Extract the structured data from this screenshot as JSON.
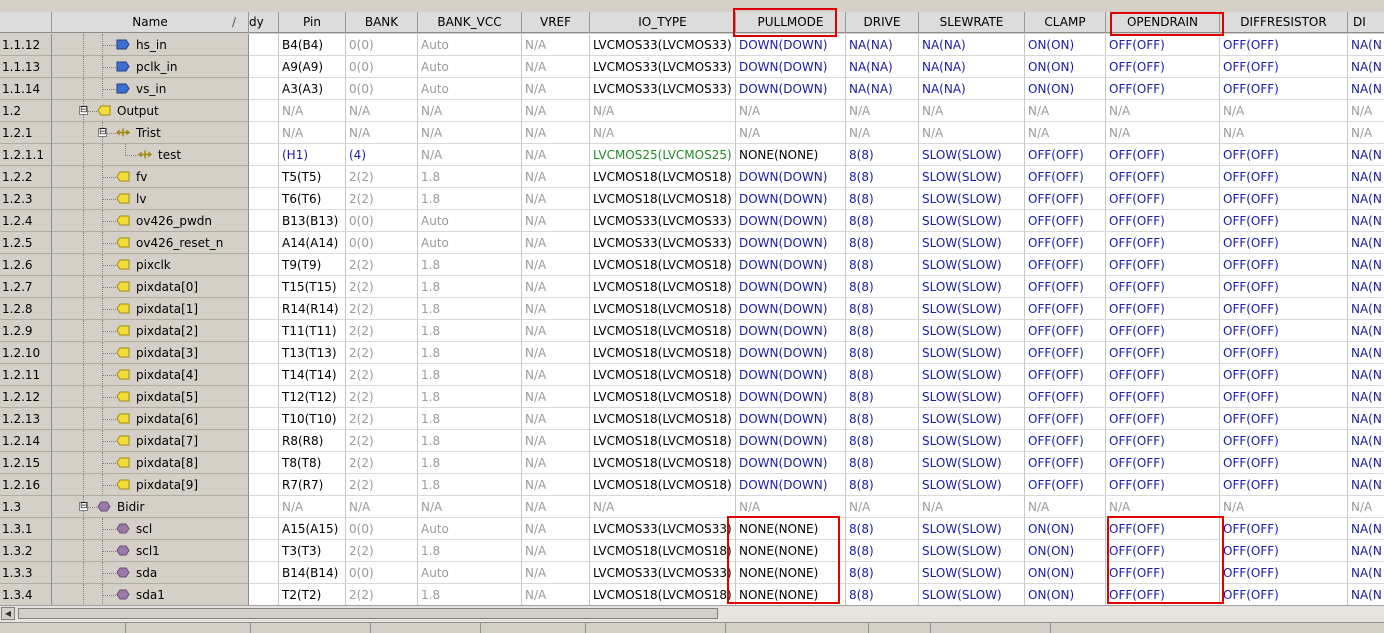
{
  "columns": [
    {
      "key": "name",
      "label": "Name"
    },
    {
      "key": "dy",
      "label": "dy"
    },
    {
      "key": "pin",
      "label": "Pin"
    },
    {
      "key": "bank",
      "label": "BANK"
    },
    {
      "key": "bank_vcc",
      "label": "BANK_VCC"
    },
    {
      "key": "vref",
      "label": "VREF"
    },
    {
      "key": "io_type",
      "label": "IO_TYPE"
    },
    {
      "key": "pullmode",
      "label": "PULLMODE"
    },
    {
      "key": "drive",
      "label": "DRIVE"
    },
    {
      "key": "slewrate",
      "label": "SLEWRATE"
    },
    {
      "key": "clamp",
      "label": "CLAMP"
    },
    {
      "key": "opendrain",
      "label": "OPENDRAIN"
    },
    {
      "key": "diffresistor",
      "label": "DIFFRESISTOR"
    },
    {
      "key": "di",
      "label": "DI"
    }
  ],
  "colors": {
    "value_blue": "#1a1aa6",
    "na_gray": "#9a9a9a",
    "iotype_green": "#238a23",
    "highlight_red": "#e00000",
    "input_icon_blue": "#3b6fd1",
    "output_icon_yellow": "#f2dc3c",
    "bidir_icon_purple": "#9a7aa8"
  },
  "rows": [
    {
      "index": "1.1.12",
      "name": "hs_in",
      "icon": "input-port-icon",
      "pin": "B4(B4)",
      "bank": "0(0)",
      "bank_vcc": "Auto",
      "vref": "N/A",
      "io_type": "LVCMOS33(LVCMOS33)",
      "pullmode": "DOWN(DOWN)",
      "drive": "NA(NA)",
      "slewrate": "NA(NA)",
      "clamp": "ON(ON)",
      "opendrain": "OFF(OFF)",
      "diffresistor": "OFF(OFF)",
      "di": "NA(N"
    },
    {
      "index": "1.1.13",
      "name": "pclk_in",
      "icon": "input-port-icon",
      "pin": "A9(A9)",
      "bank": "0(0)",
      "bank_vcc": "Auto",
      "vref": "N/A",
      "io_type": "LVCMOS33(LVCMOS33)",
      "pullmode": "DOWN(DOWN)",
      "drive": "NA(NA)",
      "slewrate": "NA(NA)",
      "clamp": "ON(ON)",
      "opendrain": "OFF(OFF)",
      "diffresistor": "OFF(OFF)",
      "di": "NA(N"
    },
    {
      "index": "1.1.14",
      "name": "vs_in",
      "icon": "input-port-icon",
      "pin": "A3(A3)",
      "bank": "0(0)",
      "bank_vcc": "Auto",
      "vref": "N/A",
      "io_type": "LVCMOS33(LVCMOS33)",
      "pullmode": "DOWN(DOWN)",
      "drive": "NA(NA)",
      "slewrate": "NA(NA)",
      "clamp": "ON(ON)",
      "opendrain": "OFF(OFF)",
      "diffresistor": "OFF(OFF)",
      "di": "NA(N"
    },
    {
      "index": "1.2",
      "name": "Output",
      "icon": "output-group-icon",
      "expander": "⊟",
      "pin": "N/A",
      "bank": "N/A",
      "bank_vcc": "N/A",
      "vref": "N/A",
      "io_type": "N/A",
      "pullmode": "N/A",
      "drive": "N/A",
      "slewrate": "N/A",
      "clamp": "N/A",
      "opendrain": "N/A",
      "diffresistor": "N/A",
      "di": "N/A"
    },
    {
      "index": "1.2.1",
      "name": "Trist",
      "icon": "tristate-group-icon",
      "expander": "⊟",
      "pin": "N/A",
      "bank": "N/A",
      "bank_vcc": "N/A",
      "vref": "N/A",
      "io_type": "N/A",
      "pullmode": "N/A",
      "drive": "N/A",
      "slewrate": "N/A",
      "clamp": "N/A",
      "opendrain": "N/A",
      "diffresistor": "N/A",
      "di": "N/A"
    },
    {
      "index": "1.2.1.1",
      "name": "test",
      "icon": "tristate-port-icon",
      "pin": "(H1)",
      "bank": "(4)",
      "bank_vcc": "N/A",
      "vref": "N/A",
      "io_type": "LVCMOS25(LVCMOS25)",
      "pullmode": "NONE(NONE)",
      "drive": "8(8)",
      "slewrate": "SLOW(SLOW)",
      "clamp": "OFF(OFF)",
      "opendrain": "OFF(OFF)",
      "diffresistor": "OFF(OFF)",
      "di": "NA(N"
    },
    {
      "index": "1.2.2",
      "name": "fv",
      "icon": "output-port-icon",
      "pin": "T5(T5)",
      "bank": "2(2)",
      "bank_vcc": "1.8",
      "vref": "N/A",
      "io_type": "LVCMOS18(LVCMOS18)",
      "pullmode": "DOWN(DOWN)",
      "drive": "8(8)",
      "slewrate": "SLOW(SLOW)",
      "clamp": "OFF(OFF)",
      "opendrain": "OFF(OFF)",
      "diffresistor": "OFF(OFF)",
      "di": "NA(N"
    },
    {
      "index": "1.2.3",
      "name": "lv",
      "icon": "output-port-icon",
      "pin": "T6(T6)",
      "bank": "2(2)",
      "bank_vcc": "1.8",
      "vref": "N/A",
      "io_type": "LVCMOS18(LVCMOS18)",
      "pullmode": "DOWN(DOWN)",
      "drive": "8(8)",
      "slewrate": "SLOW(SLOW)",
      "clamp": "OFF(OFF)",
      "opendrain": "OFF(OFF)",
      "diffresistor": "OFF(OFF)",
      "di": "NA(N"
    },
    {
      "index": "1.2.4",
      "name": "ov426_pwdn",
      "icon": "output-port-icon",
      "pin": "B13(B13)",
      "bank": "0(0)",
      "bank_vcc": "Auto",
      "vref": "N/A",
      "io_type": "LVCMOS33(LVCMOS33)",
      "pullmode": "DOWN(DOWN)",
      "drive": "8(8)",
      "slewrate": "SLOW(SLOW)",
      "clamp": "OFF(OFF)",
      "opendrain": "OFF(OFF)",
      "diffresistor": "OFF(OFF)",
      "di": "NA(N"
    },
    {
      "index": "1.2.5",
      "name": "ov426_reset_n",
      "icon": "output-port-icon",
      "pin": "A14(A14)",
      "bank": "0(0)",
      "bank_vcc": "Auto",
      "vref": "N/A",
      "io_type": "LVCMOS33(LVCMOS33)",
      "pullmode": "DOWN(DOWN)",
      "drive": "8(8)",
      "slewrate": "SLOW(SLOW)",
      "clamp": "OFF(OFF)",
      "opendrain": "OFF(OFF)",
      "diffresistor": "OFF(OFF)",
      "di": "NA(N"
    },
    {
      "index": "1.2.6",
      "name": "pixclk",
      "icon": "output-port-icon",
      "pin": "T9(T9)",
      "bank": "2(2)",
      "bank_vcc": "1.8",
      "vref": "N/A",
      "io_type": "LVCMOS18(LVCMOS18)",
      "pullmode": "DOWN(DOWN)",
      "drive": "8(8)",
      "slewrate": "SLOW(SLOW)",
      "clamp": "OFF(OFF)",
      "opendrain": "OFF(OFF)",
      "diffresistor": "OFF(OFF)",
      "di": "NA(N"
    },
    {
      "index": "1.2.7",
      "name": "pixdata[0]",
      "icon": "output-port-icon",
      "pin": "T15(T15)",
      "bank": "2(2)",
      "bank_vcc": "1.8",
      "vref": "N/A",
      "io_type": "LVCMOS18(LVCMOS18)",
      "pullmode": "DOWN(DOWN)",
      "drive": "8(8)",
      "slewrate": "SLOW(SLOW)",
      "clamp": "OFF(OFF)",
      "opendrain": "OFF(OFF)",
      "diffresistor": "OFF(OFF)",
      "di": "NA(N"
    },
    {
      "index": "1.2.8",
      "name": "pixdata[1]",
      "icon": "output-port-icon",
      "pin": "R14(R14)",
      "bank": "2(2)",
      "bank_vcc": "1.8",
      "vref": "N/A",
      "io_type": "LVCMOS18(LVCMOS18)",
      "pullmode": "DOWN(DOWN)",
      "drive": "8(8)",
      "slewrate": "SLOW(SLOW)",
      "clamp": "OFF(OFF)",
      "opendrain": "OFF(OFF)",
      "diffresistor": "OFF(OFF)",
      "di": "NA(N"
    },
    {
      "index": "1.2.9",
      "name": "pixdata[2]",
      "icon": "output-port-icon",
      "pin": "T11(T11)",
      "bank": "2(2)",
      "bank_vcc": "1.8",
      "vref": "N/A",
      "io_type": "LVCMOS18(LVCMOS18)",
      "pullmode": "DOWN(DOWN)",
      "drive": "8(8)",
      "slewrate": "SLOW(SLOW)",
      "clamp": "OFF(OFF)",
      "opendrain": "OFF(OFF)",
      "diffresistor": "OFF(OFF)",
      "di": "NA(N"
    },
    {
      "index": "1.2.10",
      "name": "pixdata[3]",
      "icon": "output-port-icon",
      "pin": "T13(T13)",
      "bank": "2(2)",
      "bank_vcc": "1.8",
      "vref": "N/A",
      "io_type": "LVCMOS18(LVCMOS18)",
      "pullmode": "DOWN(DOWN)",
      "drive": "8(8)",
      "slewrate": "SLOW(SLOW)",
      "clamp": "OFF(OFF)",
      "opendrain": "OFF(OFF)",
      "diffresistor": "OFF(OFF)",
      "di": "NA(N"
    },
    {
      "index": "1.2.11",
      "name": "pixdata[4]",
      "icon": "output-port-icon",
      "pin": "T14(T14)",
      "bank": "2(2)",
      "bank_vcc": "1.8",
      "vref": "N/A",
      "io_type": "LVCMOS18(LVCMOS18)",
      "pullmode": "DOWN(DOWN)",
      "drive": "8(8)",
      "slewrate": "SLOW(SLOW)",
      "clamp": "OFF(OFF)",
      "opendrain": "OFF(OFF)",
      "diffresistor": "OFF(OFF)",
      "di": "NA(N"
    },
    {
      "index": "1.2.12",
      "name": "pixdata[5]",
      "icon": "output-port-icon",
      "pin": "T12(T12)",
      "bank": "2(2)",
      "bank_vcc": "1.8",
      "vref": "N/A",
      "io_type": "LVCMOS18(LVCMOS18)",
      "pullmode": "DOWN(DOWN)",
      "drive": "8(8)",
      "slewrate": "SLOW(SLOW)",
      "clamp": "OFF(OFF)",
      "opendrain": "OFF(OFF)",
      "diffresistor": "OFF(OFF)",
      "di": "NA(N"
    },
    {
      "index": "1.2.13",
      "name": "pixdata[6]",
      "icon": "output-port-icon",
      "pin": "T10(T10)",
      "bank": "2(2)",
      "bank_vcc": "1.8",
      "vref": "N/A",
      "io_type": "LVCMOS18(LVCMOS18)",
      "pullmode": "DOWN(DOWN)",
      "drive": "8(8)",
      "slewrate": "SLOW(SLOW)",
      "clamp": "OFF(OFF)",
      "opendrain": "OFF(OFF)",
      "diffresistor": "OFF(OFF)",
      "di": "NA(N"
    },
    {
      "index": "1.2.14",
      "name": "pixdata[7]",
      "icon": "output-port-icon",
      "pin": "R8(R8)",
      "bank": "2(2)",
      "bank_vcc": "1.8",
      "vref": "N/A",
      "io_type": "LVCMOS18(LVCMOS18)",
      "pullmode": "DOWN(DOWN)",
      "drive": "8(8)",
      "slewrate": "SLOW(SLOW)",
      "clamp": "OFF(OFF)",
      "opendrain": "OFF(OFF)",
      "diffresistor": "OFF(OFF)",
      "di": "NA(N"
    },
    {
      "index": "1.2.15",
      "name": "pixdata[8]",
      "icon": "output-port-icon",
      "pin": "T8(T8)",
      "bank": "2(2)",
      "bank_vcc": "1.8",
      "vref": "N/A",
      "io_type": "LVCMOS18(LVCMOS18)",
      "pullmode": "DOWN(DOWN)",
      "drive": "8(8)",
      "slewrate": "SLOW(SLOW)",
      "clamp": "OFF(OFF)",
      "opendrain": "OFF(OFF)",
      "diffresistor": "OFF(OFF)",
      "di": "NA(N"
    },
    {
      "index": "1.2.16",
      "name": "pixdata[9]",
      "icon": "output-port-icon",
      "pin": "R7(R7)",
      "bank": "2(2)",
      "bank_vcc": "1.8",
      "vref": "N/A",
      "io_type": "LVCMOS18(LVCMOS18)",
      "pullmode": "DOWN(DOWN)",
      "drive": "8(8)",
      "slewrate": "SLOW(SLOW)",
      "clamp": "OFF(OFF)",
      "opendrain": "OFF(OFF)",
      "diffresistor": "OFF(OFF)",
      "di": "NA(N"
    },
    {
      "index": "1.3",
      "name": "Bidir",
      "icon": "bidir-group-icon",
      "expander": "⊟",
      "pin": "N/A",
      "bank": "N/A",
      "bank_vcc": "N/A",
      "vref": "N/A",
      "io_type": "N/A",
      "pullmode": "N/A",
      "drive": "N/A",
      "slewrate": "N/A",
      "clamp": "N/A",
      "opendrain": "N/A",
      "diffresistor": "N/A",
      "di": "N/A"
    },
    {
      "index": "1.3.1",
      "name": "scl",
      "icon": "bidir-port-icon",
      "pin": "A15(A15)",
      "bank": "0(0)",
      "bank_vcc": "Auto",
      "vref": "N/A",
      "io_type": "LVCMOS33(LVCMOS33)",
      "pullmode": "NONE(NONE)",
      "drive": "8(8)",
      "slewrate": "SLOW(SLOW)",
      "clamp": "ON(ON)",
      "opendrain": "OFF(OFF)",
      "diffresistor": "OFF(OFF)",
      "di": "NA(N"
    },
    {
      "index": "1.3.2",
      "name": "scl1",
      "icon": "bidir-port-icon",
      "pin": "T3(T3)",
      "bank": "2(2)",
      "bank_vcc": "1.8",
      "vref": "N/A",
      "io_type": "LVCMOS18(LVCMOS18)",
      "pullmode": "NONE(NONE)",
      "drive": "8(8)",
      "slewrate": "SLOW(SLOW)",
      "clamp": "ON(ON)",
      "opendrain": "OFF(OFF)",
      "diffresistor": "OFF(OFF)",
      "di": "NA(N"
    },
    {
      "index": "1.3.3",
      "name": "sda",
      "icon": "bidir-port-icon",
      "pin": "B14(B14)",
      "bank": "0(0)",
      "bank_vcc": "Auto",
      "vref": "N/A",
      "io_type": "LVCMOS33(LVCMOS33)",
      "pullmode": "NONE(NONE)",
      "drive": "8(8)",
      "slewrate": "SLOW(SLOW)",
      "clamp": "ON(ON)",
      "opendrain": "OFF(OFF)",
      "diffresistor": "OFF(OFF)",
      "di": "NA(N"
    },
    {
      "index": "1.3.4",
      "name": "sda1",
      "icon": "bidir-port-icon",
      "pin": "T2(T2)",
      "bank": "2(2)",
      "bank_vcc": "1.8",
      "vref": "N/A",
      "io_type": "LVCMOS18(LVCMOS18)",
      "pullmode": "NONE(NONE)",
      "drive": "8(8)",
      "slewrate": "SLOW(SLOW)",
      "clamp": "ON(ON)",
      "opendrain": "OFF(OFF)",
      "diffresistor": "OFF(OFF)",
      "di": "NA(N"
    }
  ]
}
